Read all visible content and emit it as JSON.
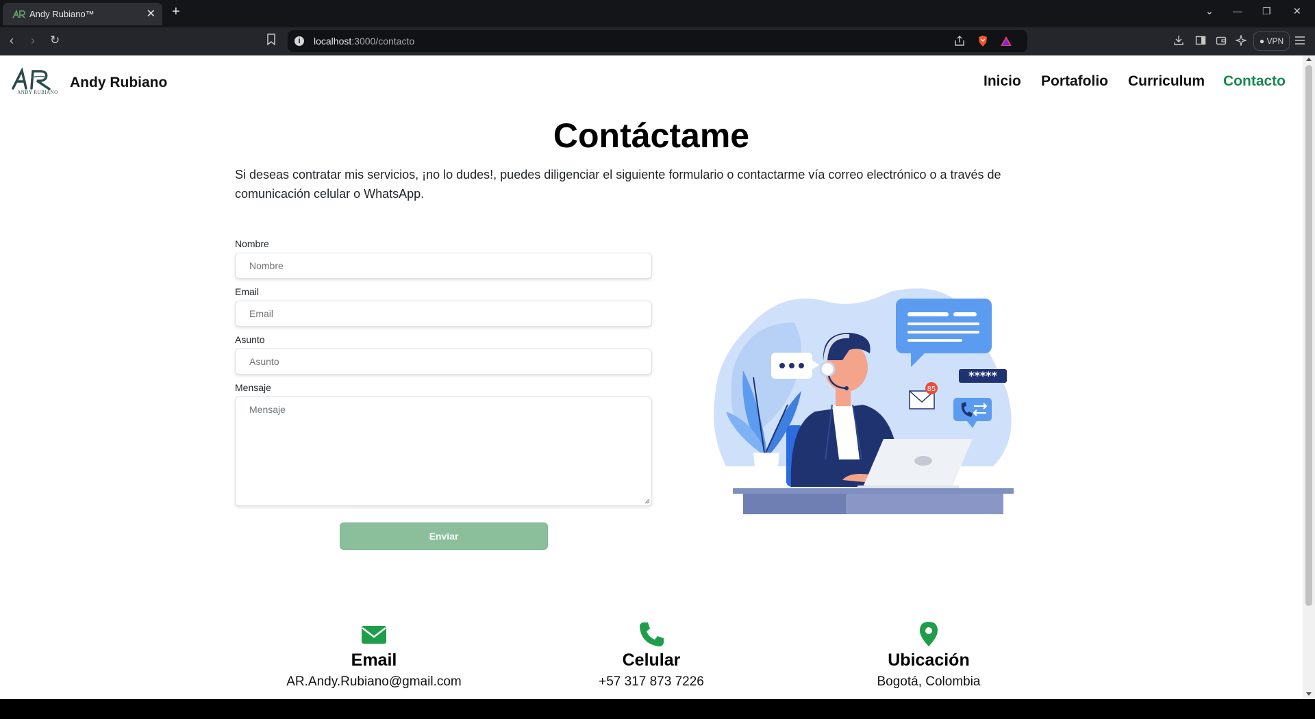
{
  "browser": {
    "tab_title": "Andy Rubiano™",
    "url_host": "localhost",
    "url_path": ":3000/contacto",
    "vpn_label": "VPN"
  },
  "navbar": {
    "logo_text": "ANDY RUBIANO",
    "brand": "Andy Rubiano",
    "links": [
      {
        "label": "Inicio",
        "active": false
      },
      {
        "label": "Portafolio",
        "active": false
      },
      {
        "label": "Curriculum",
        "active": false
      },
      {
        "label": "Contacto",
        "active": true
      }
    ],
    "active_color": "#198754"
  },
  "hero": {
    "title": "Contáctame",
    "description": "Si deseas contratar mis servicios, ¡no lo dudes!, puedes diligenciar el siguiente formulario o contactarme vía correo electrónico o a través de comunicación celular o WhatsApp."
  },
  "form": {
    "fields": [
      {
        "label": "Nombre",
        "placeholder": "Nombre",
        "value": ""
      },
      {
        "label": "Email",
        "placeholder": "Email",
        "value": ""
      },
      {
        "label": "Asunto",
        "placeholder": "Asunto",
        "value": ""
      },
      {
        "label": "Mensaje",
        "placeholder": "Mensaje",
        "value": ""
      }
    ],
    "submit_label": "Enviar",
    "submit_color": "#8bbf9b"
  },
  "illustration": {
    "icon": "customer-support-illustration",
    "badge_count": "85",
    "password_mask": "*****"
  },
  "contact_info": [
    {
      "icon": "envelope-icon",
      "title": "Email",
      "value": "AR.Andy.Rubiano@gmail.com"
    },
    {
      "icon": "phone-icon",
      "title": "Celular",
      "value": "+57 317 873 7226"
    },
    {
      "icon": "location-pin-icon",
      "title": "Ubicación",
      "value": "Bogotá, Colombia"
    }
  ],
  "accent_color": "#1e9e4a"
}
